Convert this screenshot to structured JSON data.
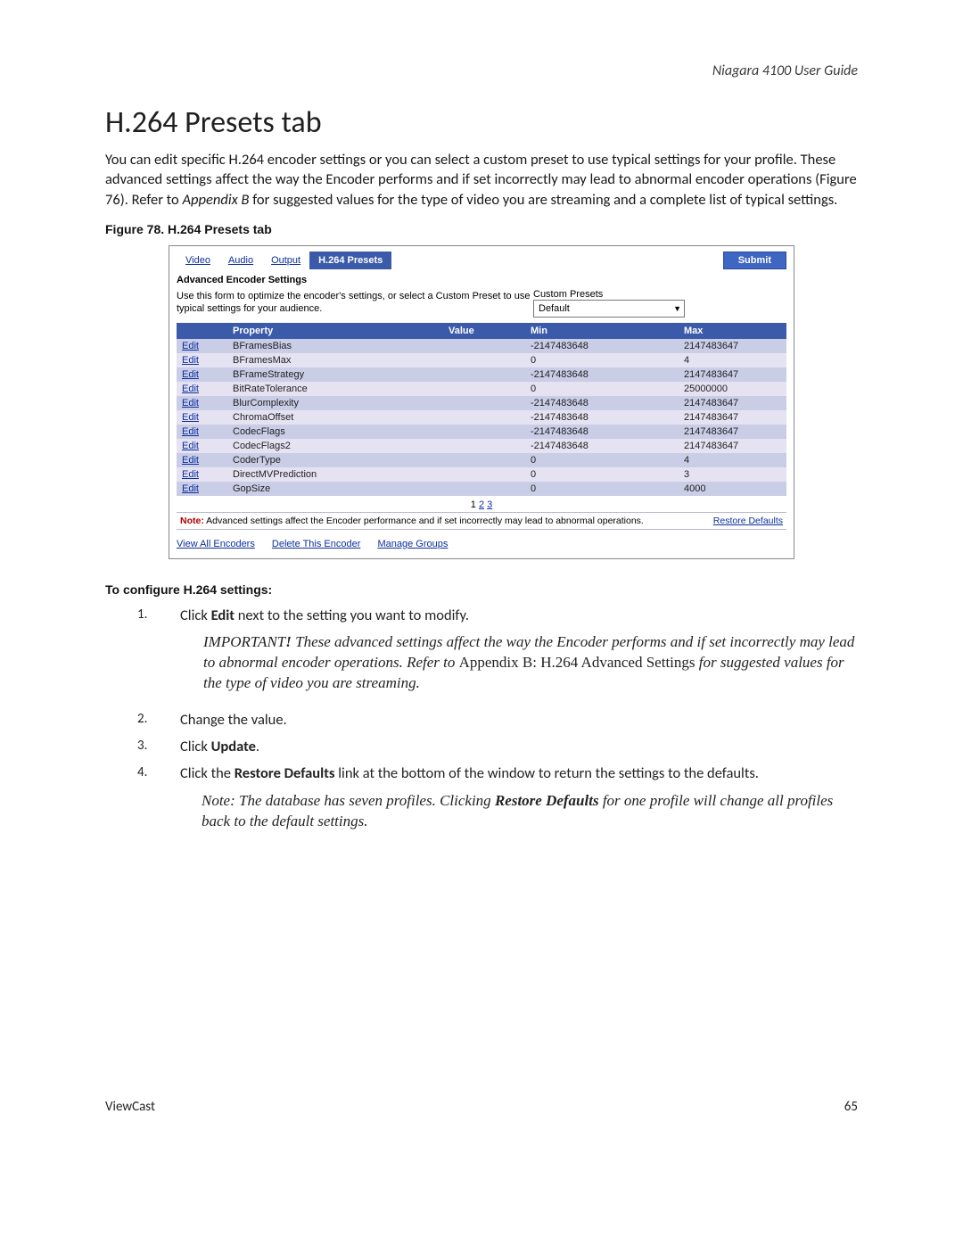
{
  "header": {
    "product": "Niagara 4100 User Guide"
  },
  "title": "H.264 Presets tab",
  "intro_parts": {
    "a": "You can edit specific H.264 encoder settings or you can select a custom preset to use typical settings for your profile. These advanced settings affect the way the Encoder performs and if set incorrectly may lead to abnormal encoder operations (Figure 76). Refer to ",
    "b": "Appendix B",
    "c": " for suggested values for the type of video you are streaming and a complete list of typical settings."
  },
  "figure_caption": "Figure 78. H.264 Presets tab",
  "panel": {
    "tabs": [
      "Video",
      "Audio",
      "Output",
      "H.264 Presets"
    ],
    "active_tab": 3,
    "submit": "Submit",
    "section_title": "Advanced Encoder Settings",
    "form_desc": "Use this form to optimize the encoder's settings, or select a Custom Preset to use typical settings for your audience.",
    "custom_label": "Custom Presets",
    "custom_value": "Default",
    "columns": [
      "",
      "Property",
      "Value",
      "Min",
      "Max"
    ],
    "rows": [
      {
        "edit": "Edit",
        "prop": "BFramesBias",
        "val": "",
        "min": "-2147483648",
        "max": "2147483647"
      },
      {
        "edit": "Edit",
        "prop": "BFramesMax",
        "val": "",
        "min": "0",
        "max": "4"
      },
      {
        "edit": "Edit",
        "prop": "BFrameStrategy",
        "val": "",
        "min": "-2147483648",
        "max": "2147483647"
      },
      {
        "edit": "Edit",
        "prop": "BitRateTolerance",
        "val": "",
        "min": "0",
        "max": "25000000"
      },
      {
        "edit": "Edit",
        "prop": "BlurComplexity",
        "val": "",
        "min": "-2147483648",
        "max": "2147483647"
      },
      {
        "edit": "Edit",
        "prop": "ChromaOffset",
        "val": "",
        "min": "-2147483648",
        "max": "2147483647"
      },
      {
        "edit": "Edit",
        "prop": "CodecFlags",
        "val": "",
        "min": "-2147483648",
        "max": "2147483647"
      },
      {
        "edit": "Edit",
        "prop": "CodecFlags2",
        "val": "",
        "min": "-2147483648",
        "max": "2147483647"
      },
      {
        "edit": "Edit",
        "prop": "CoderType",
        "val": "",
        "min": "0",
        "max": "4"
      },
      {
        "edit": "Edit",
        "prop": "DirectMVPrediction",
        "val": "",
        "min": "0",
        "max": "3"
      },
      {
        "edit": "Edit",
        "prop": "GopSize",
        "val": "",
        "min": "0",
        "max": "4000"
      }
    ],
    "pager": {
      "cur": "1",
      "rest": [
        "2",
        "3"
      ]
    },
    "note_label": "Note:",
    "note_text": " Advanced settings affect the Encoder performance and if set incorrectly may lead to abnormal operations.",
    "restore": "Restore Defaults",
    "links": [
      "View All Encoders",
      "Delete This Encoder",
      "Manage Groups"
    ]
  },
  "configure_heading": "To configure H.264 settings:",
  "steps": [
    {
      "n": "1.",
      "pre": "Click ",
      "b": "Edit",
      "post": " next to the setting you want to modify."
    },
    {
      "n": "2.",
      "pre": "Change the value.",
      "b": "",
      "post": ""
    },
    {
      "n": "3.",
      "pre": "Click ",
      "b": "Update",
      "post": "."
    },
    {
      "n": "4.",
      "pre": "Click the ",
      "b": "Restore Defaults",
      "post": " link at the bottom of the window to return the settings to the defaults."
    }
  ],
  "important": {
    "lead": "IMPORTANT",
    "exc": "!",
    "a": " These advanced settings affect the way the Encoder performs and if set incorrectly may lead to abnormal encoder operations. Refer to ",
    "link": "Appendix B: H.264 Advanced Settings",
    "b": " for suggested values for the type of video you are streaming."
  },
  "note_step4": {
    "a": "Note: The database has seven profiles. Clicking ",
    "b": "Restore Defaults",
    "c": " for one profile will change all profiles back to the default settings."
  },
  "footer": {
    "left": "ViewCast",
    "right": "65"
  }
}
